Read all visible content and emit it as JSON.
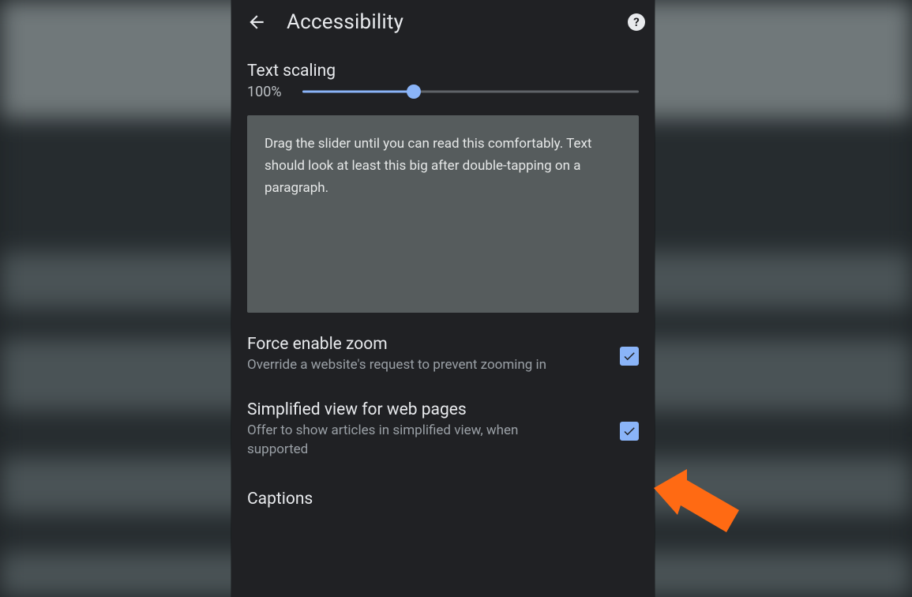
{
  "header": {
    "title": "Accessibility"
  },
  "textScaling": {
    "label": "Text scaling",
    "value": "100%",
    "percent": 33,
    "preview": "Drag the slider until you can read this comfortably. Text should look at least this big after double-tapping on a paragraph."
  },
  "settings": [
    {
      "title": "Force enable zoom",
      "subtitle": "Override a website's request to prevent zooming in",
      "checked": true
    },
    {
      "title": "Simplified view for web pages",
      "subtitle": "Offer to show articles in simplified view, when supported",
      "checked": true
    }
  ],
  "captions": {
    "title": "Captions"
  }
}
